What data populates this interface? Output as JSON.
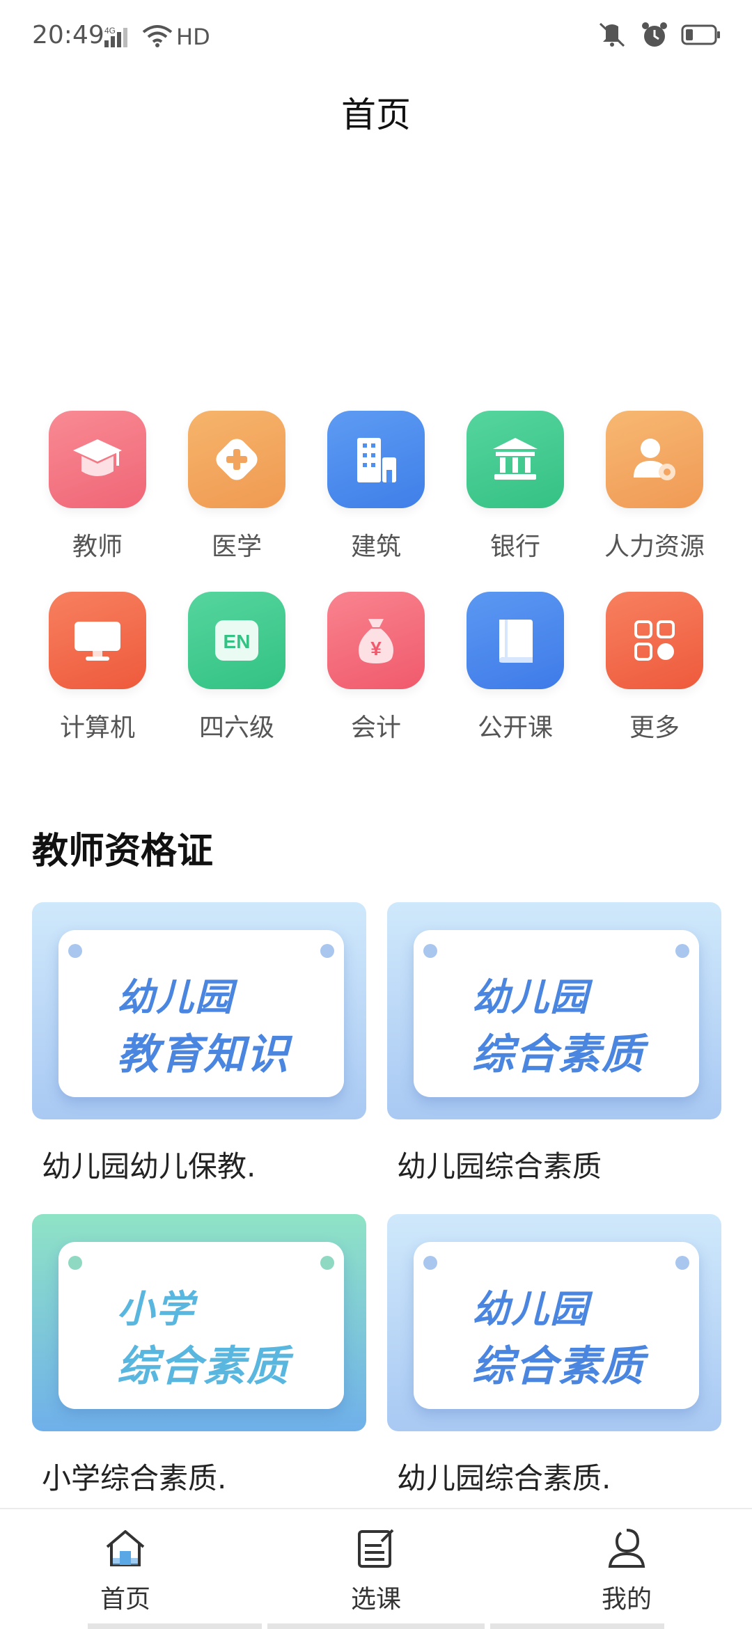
{
  "status_bar": {
    "time": "20:49",
    "network": "4G",
    "hd": "HD"
  },
  "header": {
    "title": "首页"
  },
  "categories": [
    {
      "label": "教师",
      "icon": "graduation-cap-icon",
      "color": "#f4707e"
    },
    {
      "label": "医学",
      "icon": "medical-cross-icon",
      "color": "#f2a35d"
    },
    {
      "label": "建筑",
      "icon": "building-icon",
      "color": "#4f8ff0"
    },
    {
      "label": "银行",
      "icon": "bank-icon",
      "color": "#3fc98e"
    },
    {
      "label": "人力资源",
      "icon": "person-gear-icon",
      "color": "#f3a561"
    },
    {
      "label": "计算机",
      "icon": "monitor-icon",
      "color": "#f26a48"
    },
    {
      "label": "四六级",
      "icon": "english-icon",
      "color": "#3fcb8f",
      "text": "EN"
    },
    {
      "label": "会计",
      "icon": "money-bag-icon",
      "color": "#f46a7a",
      "text": "¥"
    },
    {
      "label": "公开课",
      "icon": "book-icon",
      "color": "#4a86ee"
    },
    {
      "label": "更多",
      "icon": "grid-more-icon",
      "color": "#f26a4c"
    }
  ],
  "section": {
    "title": "教师资格证"
  },
  "courses": [
    {
      "line1": "幼儿园",
      "line2": "教育知识",
      "caption": "幼儿园幼儿保教.",
      "theme": "blue"
    },
    {
      "line1": "幼儿园",
      "line2": "综合素质",
      "caption": "幼儿园综合素质",
      "theme": "blue"
    },
    {
      "line1": "小学",
      "line2": "综合素质",
      "caption": "小学综合素质.",
      "theme": "green"
    },
    {
      "line1": "幼儿园",
      "line2": "综合素质",
      "caption": "幼儿园综合素质.",
      "theme": "blue"
    }
  ],
  "bottom_nav": [
    {
      "label": "首页",
      "icon": "home-icon",
      "active": true
    },
    {
      "label": "选课",
      "icon": "select-course-icon",
      "active": false
    },
    {
      "label": "我的",
      "icon": "profile-icon",
      "active": false
    }
  ]
}
